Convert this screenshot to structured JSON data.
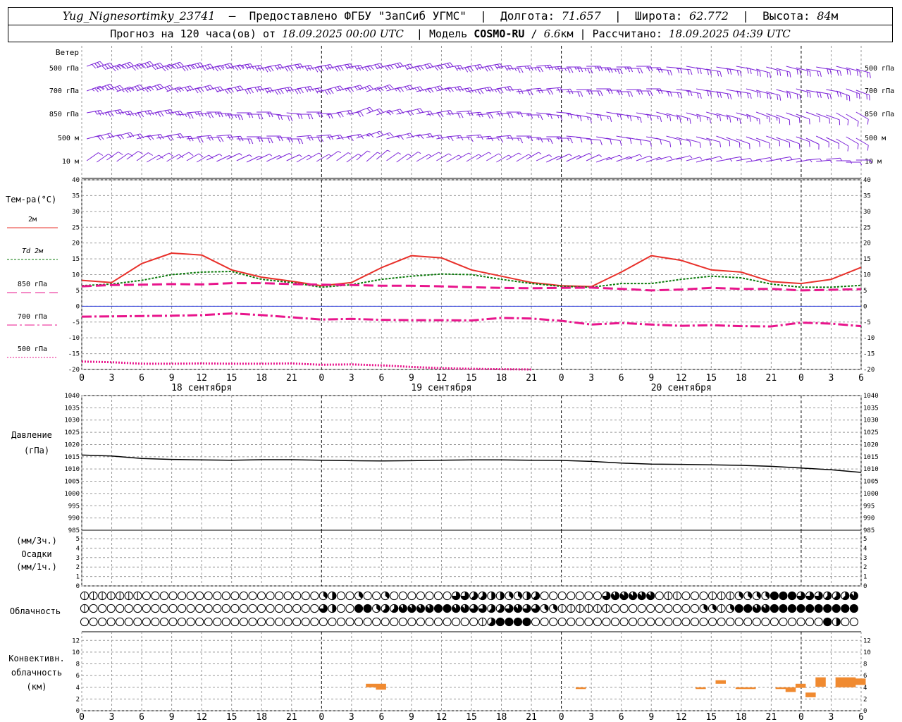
{
  "header": {
    "station": "Yug_Nignesortimky_23741",
    "provider_text": "Предоставлено ФГБУ \"ЗапСиб УГМС\"",
    "lon_label": "Долгота:",
    "lon_value": "71.657",
    "lat_label": "Широта:",
    "lat_value": "62.772",
    "alt_label": "Высота:",
    "alt_value": "84",
    "alt_unit": "м",
    "forecast_text": "Прогноз на 120 часа(ов) от",
    "forecast_start": "18.09.2025 00:00 UTC",
    "model_label": "Модель",
    "model_name": "COSMO-RU",
    "model_res": "6.6",
    "model_res_unit": "км",
    "calc_label": "Рассчитано:",
    "calc_time": "18.09.2025 04:39 UTC"
  },
  "labels": {
    "wind_title": "Ветер",
    "wind_levels": [
      "500 гПа",
      "700 гПа",
      "850 гПа",
      "500 м",
      "10  м"
    ],
    "temp_title": "Тем-ра(°С)",
    "temp_legend": [
      "2м",
      "Td  2м",
      "850 гПа",
      "700 гПа",
      "500 гПа"
    ],
    "pressure_title": [
      "Давление",
      "(гПа)"
    ],
    "precip_title": [
      "(мм/3ч.)",
      "Осадки",
      "(мм/1ч.)"
    ],
    "cloud_title": "Облачность",
    "conv_title": [
      "Конвективн.",
      "облачность",
      "(км)"
    ],
    "days": [
      "18 сентября",
      "19 сентября",
      "20 сентября"
    ]
  },
  "colors": {
    "wind": "#7b22d8",
    "t2m": "#e8302a",
    "td2m": "#0a7a0a",
    "t850": "#e8158c",
    "t700": "#e8158c",
    "t500": "#e8158c",
    "pressure": "#000000",
    "convective": "#f08a30",
    "zero_line": "#2c3cd8"
  },
  "chart_data": [
    {
      "type": "line",
      "title": "Тем-ра(°С)",
      "x_hours": [
        0,
        3,
        6,
        9,
        12,
        15,
        18,
        21,
        24,
        27,
        30,
        33,
        36,
        39,
        42,
        45,
        48,
        51,
        54,
        57,
        60,
        63,
        66,
        69,
        72,
        75,
        78
      ],
      "x_tick_labels": [
        "0",
        "3",
        "6",
        "9",
        "12",
        "15",
        "18",
        "21",
        "0",
        "3",
        "6",
        "9",
        "12",
        "15",
        "18",
        "21",
        "0",
        "3",
        "6",
        "9",
        "12",
        "15",
        "18",
        "21",
        "0",
        "3",
        "6"
      ],
      "ylim": [
        -20,
        40
      ],
      "y_ticks": [
        -20,
        -15,
        -10,
        -5,
        0,
        5,
        10,
        15,
        20,
        25,
        30,
        35,
        40
      ],
      "series": [
        {
          "name": "2м",
          "values": [
            8.2,
            7.5,
            13.5,
            16.8,
            16.2,
            11.5,
            9.2,
            7.9,
            6.5,
            7.5,
            12.2,
            16.0,
            15.3,
            11.5,
            9.5,
            7.5,
            6.5,
            6.2,
            10.8,
            16.0,
            14.5,
            11.5,
            10.8,
            7.8,
            7.2,
            8.5,
            12.3
          ]
        },
        {
          "name": "Td  2м",
          "values": [
            6.5,
            7.0,
            8.2,
            10.0,
            10.8,
            11.0,
            8.5,
            7.5,
            6.0,
            6.8,
            8.5,
            9.5,
            10.2,
            10.0,
            8.5,
            7.2,
            6.3,
            6.0,
            7.2,
            7.2,
            8.5,
            9.5,
            9.0,
            7.0,
            6.0,
            6.0,
            6.6
          ]
        },
        {
          "name": "850 гПа",
          "values": [
            6.3,
            6.7,
            6.8,
            7.0,
            6.9,
            7.3,
            7.3,
            7.0,
            6.8,
            6.7,
            6.5,
            6.5,
            6.3,
            6.0,
            5.8,
            5.7,
            5.8,
            5.9,
            5.5,
            5.0,
            5.3,
            5.8,
            5.5,
            5.5,
            5.0,
            5.2,
            5.4
          ]
        },
        {
          "name": "700 гПа",
          "values": [
            -3.3,
            -3.2,
            -3.1,
            -3.0,
            -2.8,
            -2.3,
            -2.8,
            -3.5,
            -4.2,
            -4.0,
            -4.3,
            -4.4,
            -4.4,
            -4.5,
            -3.7,
            -3.9,
            -4.6,
            -5.8,
            -5.3,
            -5.8,
            -6.2,
            -6.0,
            -6.3,
            -6.4,
            -5.2,
            -5.5,
            -6.3
          ]
        },
        {
          "name": "500 гПа",
          "values": [
            -17.5,
            -17.7,
            -18.2,
            -18.2,
            -18.1,
            -18.2,
            -18.2,
            -18.1,
            -18.5,
            -18.4,
            -18.7,
            -19.2,
            -19.6,
            -19.8,
            -19.9,
            -20.0,
            null,
            -20.0,
            null,
            null,
            null,
            null,
            null,
            null,
            null,
            null,
            null
          ]
        }
      ]
    },
    {
      "type": "line",
      "title": "Давление (гПа)",
      "x_hours": [
        0,
        3,
        6,
        9,
        12,
        15,
        18,
        21,
        24,
        27,
        30,
        33,
        36,
        39,
        42,
        45,
        48,
        51,
        54,
        57,
        60,
        63,
        66,
        69,
        72,
        75,
        78
      ],
      "ylim": [
        985,
        1040
      ],
      "y_ticks": [
        985,
        990,
        995,
        1000,
        1005,
        1010,
        1015,
        1020,
        1025,
        1030,
        1035,
        1040
      ],
      "series": [
        {
          "name": "Давление",
          "values": [
            1015.7,
            1015.3,
            1014.3,
            1013.9,
            1013.7,
            1013.6,
            1013.8,
            1013.8,
            1013.6,
            1013.4,
            1013.3,
            1013.4,
            1013.6,
            1013.7,
            1013.7,
            1013.6,
            1013.5,
            1013.1,
            1012.4,
            1012.0,
            1011.9,
            1011.7,
            1011.5,
            1011.1,
            1010.4,
            1009.7,
            1008.6
          ]
        }
      ]
    },
    {
      "type": "bar",
      "title": "Осадки",
      "ylim": [
        0,
        5
      ],
      "y_ticks": [
        0,
        1,
        2,
        3,
        4,
        5
      ],
      "values": []
    },
    {
      "type": "bar",
      "title": "Конвективн. облачность (км)",
      "ylim": [
        0,
        13
      ],
      "y_ticks": [
        0,
        2,
        4,
        6,
        8,
        10,
        12
      ],
      "bars_hours_base_top_km": [
        [
          29,
          4.0,
          4.6
        ],
        [
          30,
          3.6,
          4.6
        ],
        [
          50,
          3.7,
          4.0
        ],
        [
          62,
          3.7,
          4.0
        ],
        [
          64,
          4.6,
          5.2
        ],
        [
          66,
          3.7,
          4.0
        ],
        [
          67,
          3.7,
          4.0
        ],
        [
          70,
          3.7,
          4.0
        ],
        [
          71,
          3.2,
          4.0
        ],
        [
          72,
          3.9,
          4.6
        ],
        [
          73,
          2.3,
          3.1
        ],
        [
          74,
          4.1,
          5.7
        ],
        [
          76,
          4.0,
          5.7
        ],
        [
          77,
          4.0,
          5.7
        ],
        [
          78,
          4.4,
          5.5
        ]
      ]
    },
    {
      "type": "table",
      "title": "Облачность",
      "rows_levels": [
        "upper",
        "middle",
        "lower"
      ],
      "cover_eighths": {
        "upper": [
          2,
          2,
          2,
          2,
          1,
          1,
          1,
          0,
          0,
          0,
          0,
          0,
          0,
          0,
          0,
          0,
          0,
          0,
          0,
          0,
          0,
          0,
          0,
          0,
          0,
          0,
          0,
          3,
          4,
          0,
          0,
          3,
          0,
          0,
          3,
          0,
          0,
          0,
          0,
          0,
          0,
          0,
          6,
          6,
          5,
          5,
          4,
          4,
          3,
          3,
          4,
          5,
          0,
          0,
          0,
          0,
          0,
          0,
          0,
          6,
          7,
          7,
          7,
          7,
          7,
          0,
          2,
          2,
          0,
          0,
          0,
          2,
          2,
          2,
          3,
          3,
          3,
          3,
          8,
          8,
          8,
          6,
          6,
          6,
          5,
          5,
          5,
          7
        ],
        "middle": [
          2,
          0,
          0,
          0,
          0,
          0,
          0,
          0,
          0,
          0,
          0,
          0,
          0,
          0,
          0,
          0,
          0,
          0,
          0,
          0,
          0,
          0,
          0,
          0,
          0,
          0,
          0,
          6,
          4,
          0,
          0,
          8,
          8,
          3,
          5,
          5,
          7,
          7,
          7,
          7,
          8,
          8,
          7,
          7,
          6,
          6,
          5,
          5,
          6,
          7,
          6,
          6,
          3,
          3,
          2,
          2,
          2,
          2,
          2,
          2,
          0,
          0,
          0,
          0,
          0,
          0,
          0,
          0,
          0,
          0,
          3,
          3,
          2,
          3,
          8,
          8,
          7,
          7,
          8,
          8,
          8,
          8,
          8,
          8,
          8,
          8,
          8,
          8
        ],
        "lower": [
          0,
          0,
          0,
          0,
          0,
          0,
          0,
          0,
          0,
          0,
          0,
          0,
          0,
          0,
          0,
          0,
          0,
          0,
          0,
          0,
          0,
          0,
          0,
          0,
          0,
          0,
          0,
          0,
          0,
          0,
          0,
          0,
          0,
          0,
          0,
          0,
          0,
          0,
          0,
          0,
          0,
          0,
          0,
          0,
          0,
          1,
          5,
          8,
          8,
          8,
          8,
          0,
          0,
          0,
          0,
          0,
          0,
          0,
          0,
          0,
          0,
          0,
          0,
          0,
          0,
          0,
          0,
          0,
          0,
          0,
          0,
          0,
          0,
          0,
          0,
          0,
          0,
          0,
          0,
          0,
          0,
          0,
          0,
          0,
          8,
          4,
          0,
          0
        ]
      }
    },
    {
      "type": "scatter",
      "title": "Ветер",
      "levels": [
        "500 гПа",
        "700 гПа",
        "850 гПа",
        "500 м",
        "10  м"
      ],
      "x_hours": [
        0,
        3,
        6,
        9,
        12,
        15,
        18,
        21,
        24,
        27,
        30,
        33,
        36,
        39,
        42,
        45,
        48,
        51,
        54,
        57,
        60,
        63,
        66,
        69,
        72,
        75,
        78
      ],
      "direction_deg": {
        "500 гПа": [
          250,
          250,
          250,
          255,
          255,
          260,
          260,
          260,
          260,
          255,
          255,
          255,
          260,
          260,
          265,
          265,
          270,
          270,
          270,
          275,
          280,
          280,
          285,
          285,
          280,
          285,
          290
        ],
        "700 гПа": [
          250,
          250,
          250,
          255,
          255,
          260,
          260,
          260,
          255,
          250,
          255,
          255,
          260,
          260,
          265,
          265,
          270,
          270,
          270,
          275,
          280,
          280,
          285,
          285,
          280,
          290,
          300
        ],
        "850 гПа": [
          260,
          260,
          260,
          265,
          270,
          270,
          275,
          270,
          260,
          250,
          255,
          260,
          265,
          265,
          270,
          275,
          280,
          280,
          280,
          285,
          285,
          285,
          290,
          290,
          290,
          300,
          310
        ],
        "500 м": [
          255,
          255,
          260,
          265,
          265,
          270,
          270,
          265,
          260,
          250,
          255,
          260,
          265,
          265,
          270,
          270,
          275,
          280,
          280,
          285,
          285,
          290,
          290,
          290,
          295,
          300,
          310
        ],
        "10  м": [
          235,
          235,
          240,
          240,
          245,
          245,
          245,
          240,
          235,
          230,
          235,
          240,
          240,
          240,
          240,
          245,
          245,
          250,
          250,
          255,
          255,
          260,
          260,
          260,
          265,
          270,
          275
        ]
      },
      "speed_ms": {
        "500 гПа": [
          22,
          22,
          21,
          20,
          19,
          18,
          17,
          17,
          16,
          16,
          16,
          16,
          15,
          15,
          14,
          14,
          13,
          13,
          12,
          12,
          12,
          12,
          12,
          11,
          11,
          11,
          12
        ],
        "700 гПа": [
          18,
          18,
          17,
          17,
          16,
          16,
          15,
          15,
          14,
          14,
          14,
          13,
          13,
          13,
          12,
          12,
          12,
          11,
          11,
          11,
          11,
          11,
          10,
          10,
          10,
          10,
          11
        ],
        "850 гПа": [
          14,
          14,
          14,
          13,
          13,
          12,
          12,
          11,
          11,
          11,
          11,
          10,
          10,
          10,
          9,
          9,
          9,
          9,
          8,
          8,
          8,
          8,
          8,
          7,
          7,
          7,
          8
        ],
        "500 м": [
          12,
          12,
          11,
          11,
          11,
          10,
          10,
          10,
          9,
          9,
          9,
          9,
          8,
          8,
          8,
          8,
          7,
          7,
          7,
          7,
          7,
          6,
          6,
          6,
          6,
          6,
          7
        ],
        "10  м": [
          5,
          5,
          5,
          5,
          4,
          4,
          4,
          4,
          4,
          3,
          3,
          3,
          3,
          3,
          3,
          3,
          3,
          3,
          3,
          3,
          3,
          3,
          3,
          3,
          3,
          3,
          3
        ]
      }
    }
  ]
}
